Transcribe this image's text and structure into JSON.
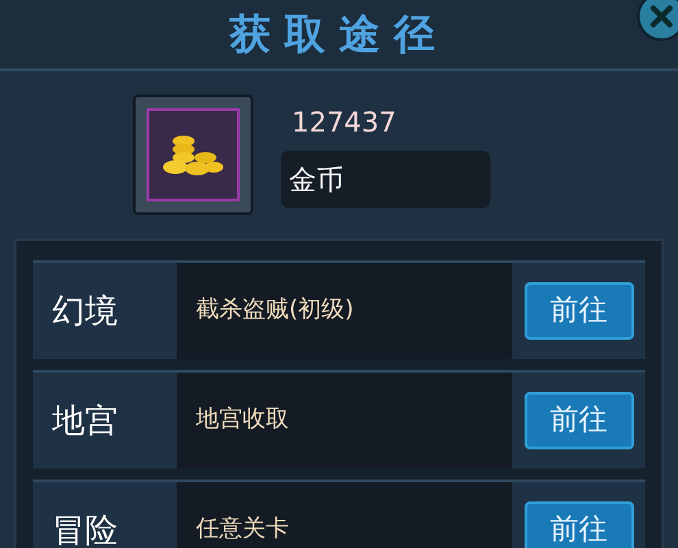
{
  "window": {
    "title": "获取途径"
  },
  "item": {
    "amount": "127437",
    "name": "金币"
  },
  "sources": [
    {
      "category": "幻境",
      "description": "截杀盗贼(初级)",
      "button": "前往"
    },
    {
      "category": "地宫",
      "description": "地宫收取",
      "button": "前往"
    },
    {
      "category": "冒险",
      "description": "任意关卡",
      "button": "前往"
    }
  ]
}
